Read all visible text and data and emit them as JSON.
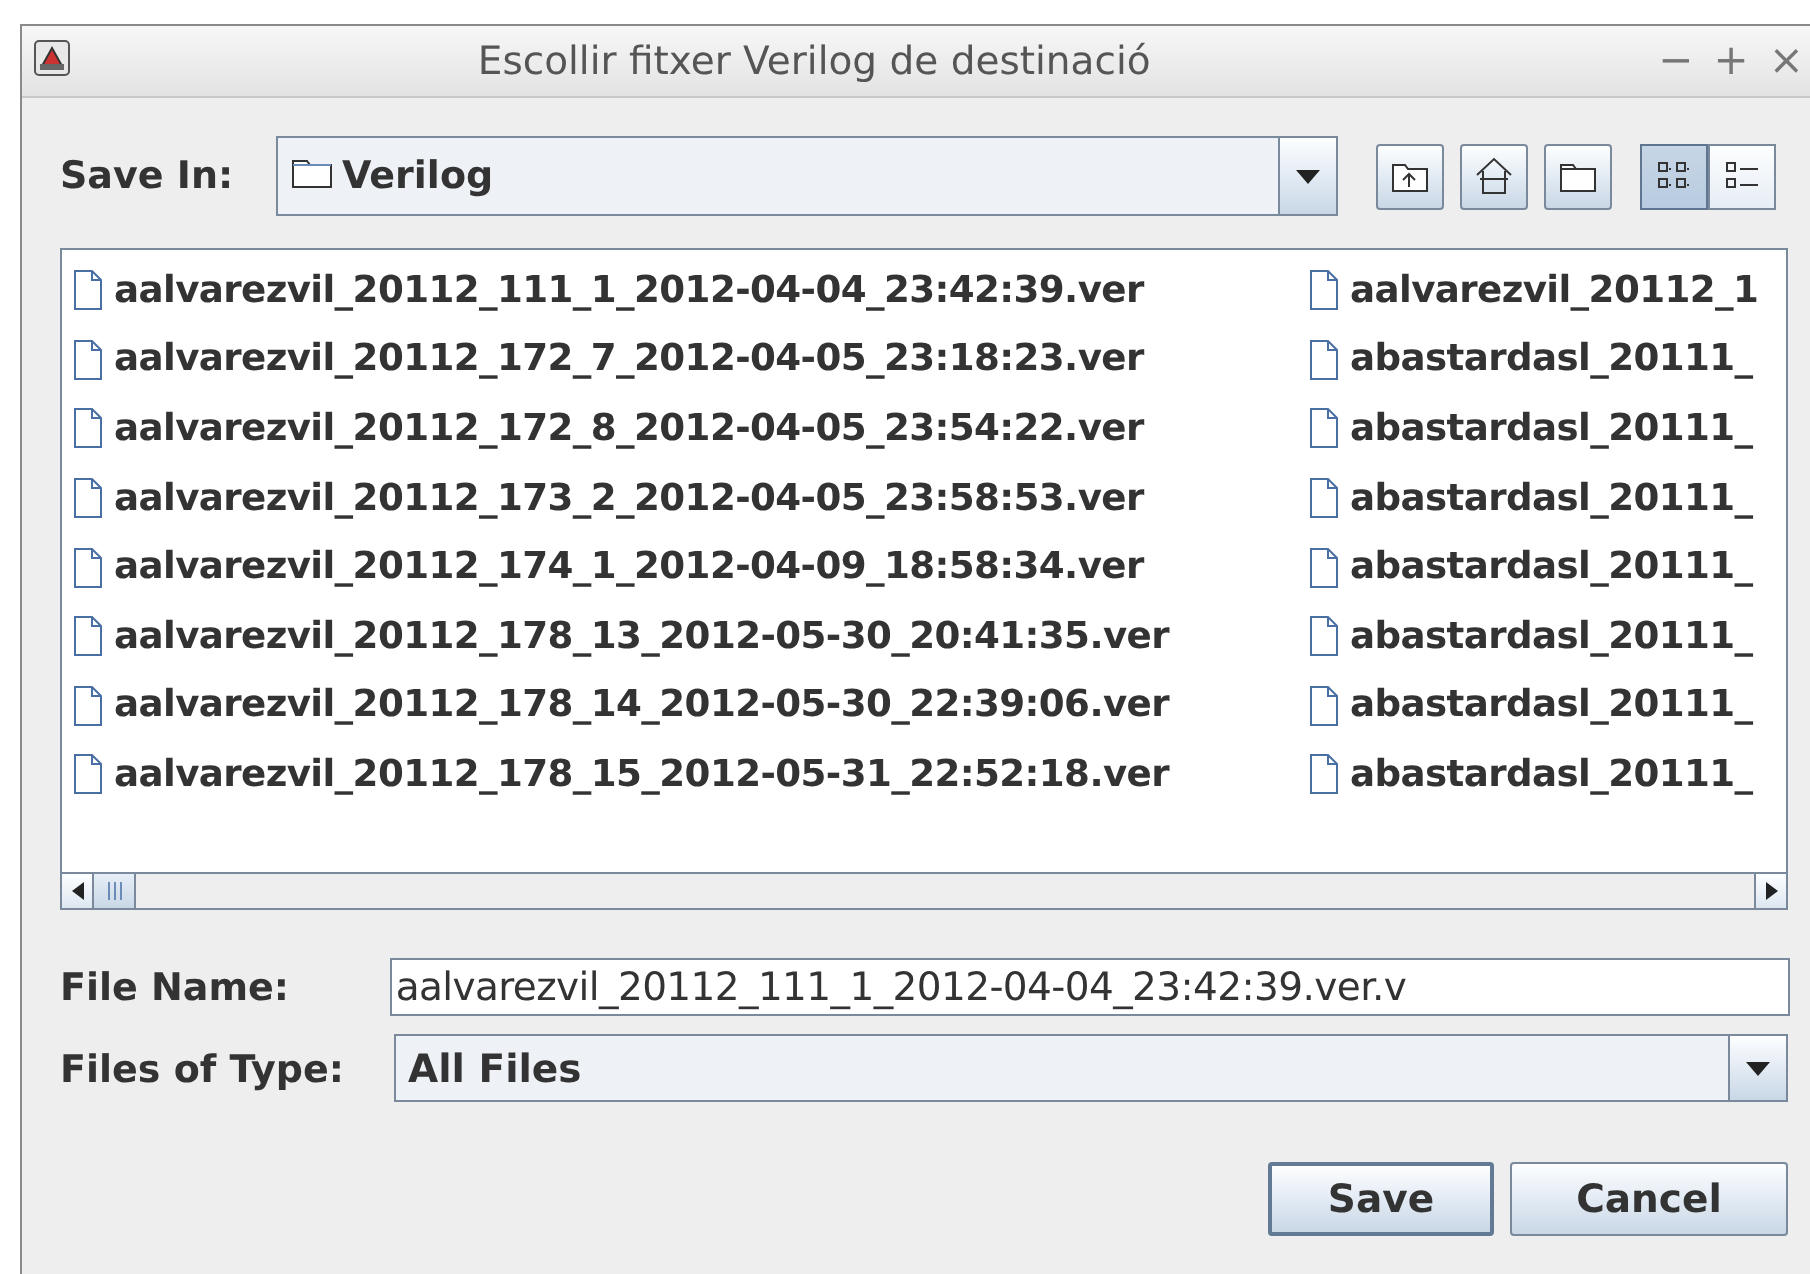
{
  "window": {
    "title": "Escollir fitxer Verilog de destinació",
    "controls": [
      "−",
      "+",
      "×"
    ]
  },
  "save_in": {
    "label": "Save In:",
    "value": "Verilog"
  },
  "toolbar_buttons": [
    {
      "kind": "up-folder"
    },
    {
      "kind": "home"
    },
    {
      "kind": "new-folder"
    }
  ],
  "view_buttons": [
    {
      "kind": "list",
      "selected": true
    },
    {
      "kind": "details",
      "selected": false
    }
  ],
  "file_list": {
    "columns": [
      [
        "aalvarezvil_20112_111_1_2012-04-04_23:42:39.ver",
        "aalvarezvil_20112_172_7_2012-04-05_23:18:23.ver",
        "aalvarezvil_20112_172_8_2012-04-05_23:54:22.ver",
        "aalvarezvil_20112_173_2_2012-04-05_23:58:53.ver",
        "aalvarezvil_20112_174_1_2012-04-09_18:58:34.ver",
        "aalvarezvil_20112_178_13_2012-05-30_20:41:35.ver",
        "aalvarezvil_20112_178_14_2012-05-30_22:39:06.ver",
        "aalvarezvil_20112_178_15_2012-05-31_22:52:18.ver"
      ],
      [
        "aalvarezvil_20112_1",
        "abastardasl_20111_",
        "abastardasl_20111_",
        "abastardasl_20111_",
        "abastardasl_20111_",
        "abastardasl_20111_",
        "abastardasl_20111_",
        "abastardasl_20111_"
      ]
    ]
  },
  "file_name": {
    "label": "File Name:",
    "value": "aalvarezvil_20112_111_1_2012-04-04_23:42:39.ver.v"
  },
  "file_type": {
    "label": "Files of Type:",
    "value": "All Files"
  },
  "buttons": [
    {
      "label": "Save",
      "default": true
    },
    {
      "label": "Cancel",
      "default": false
    }
  ]
}
